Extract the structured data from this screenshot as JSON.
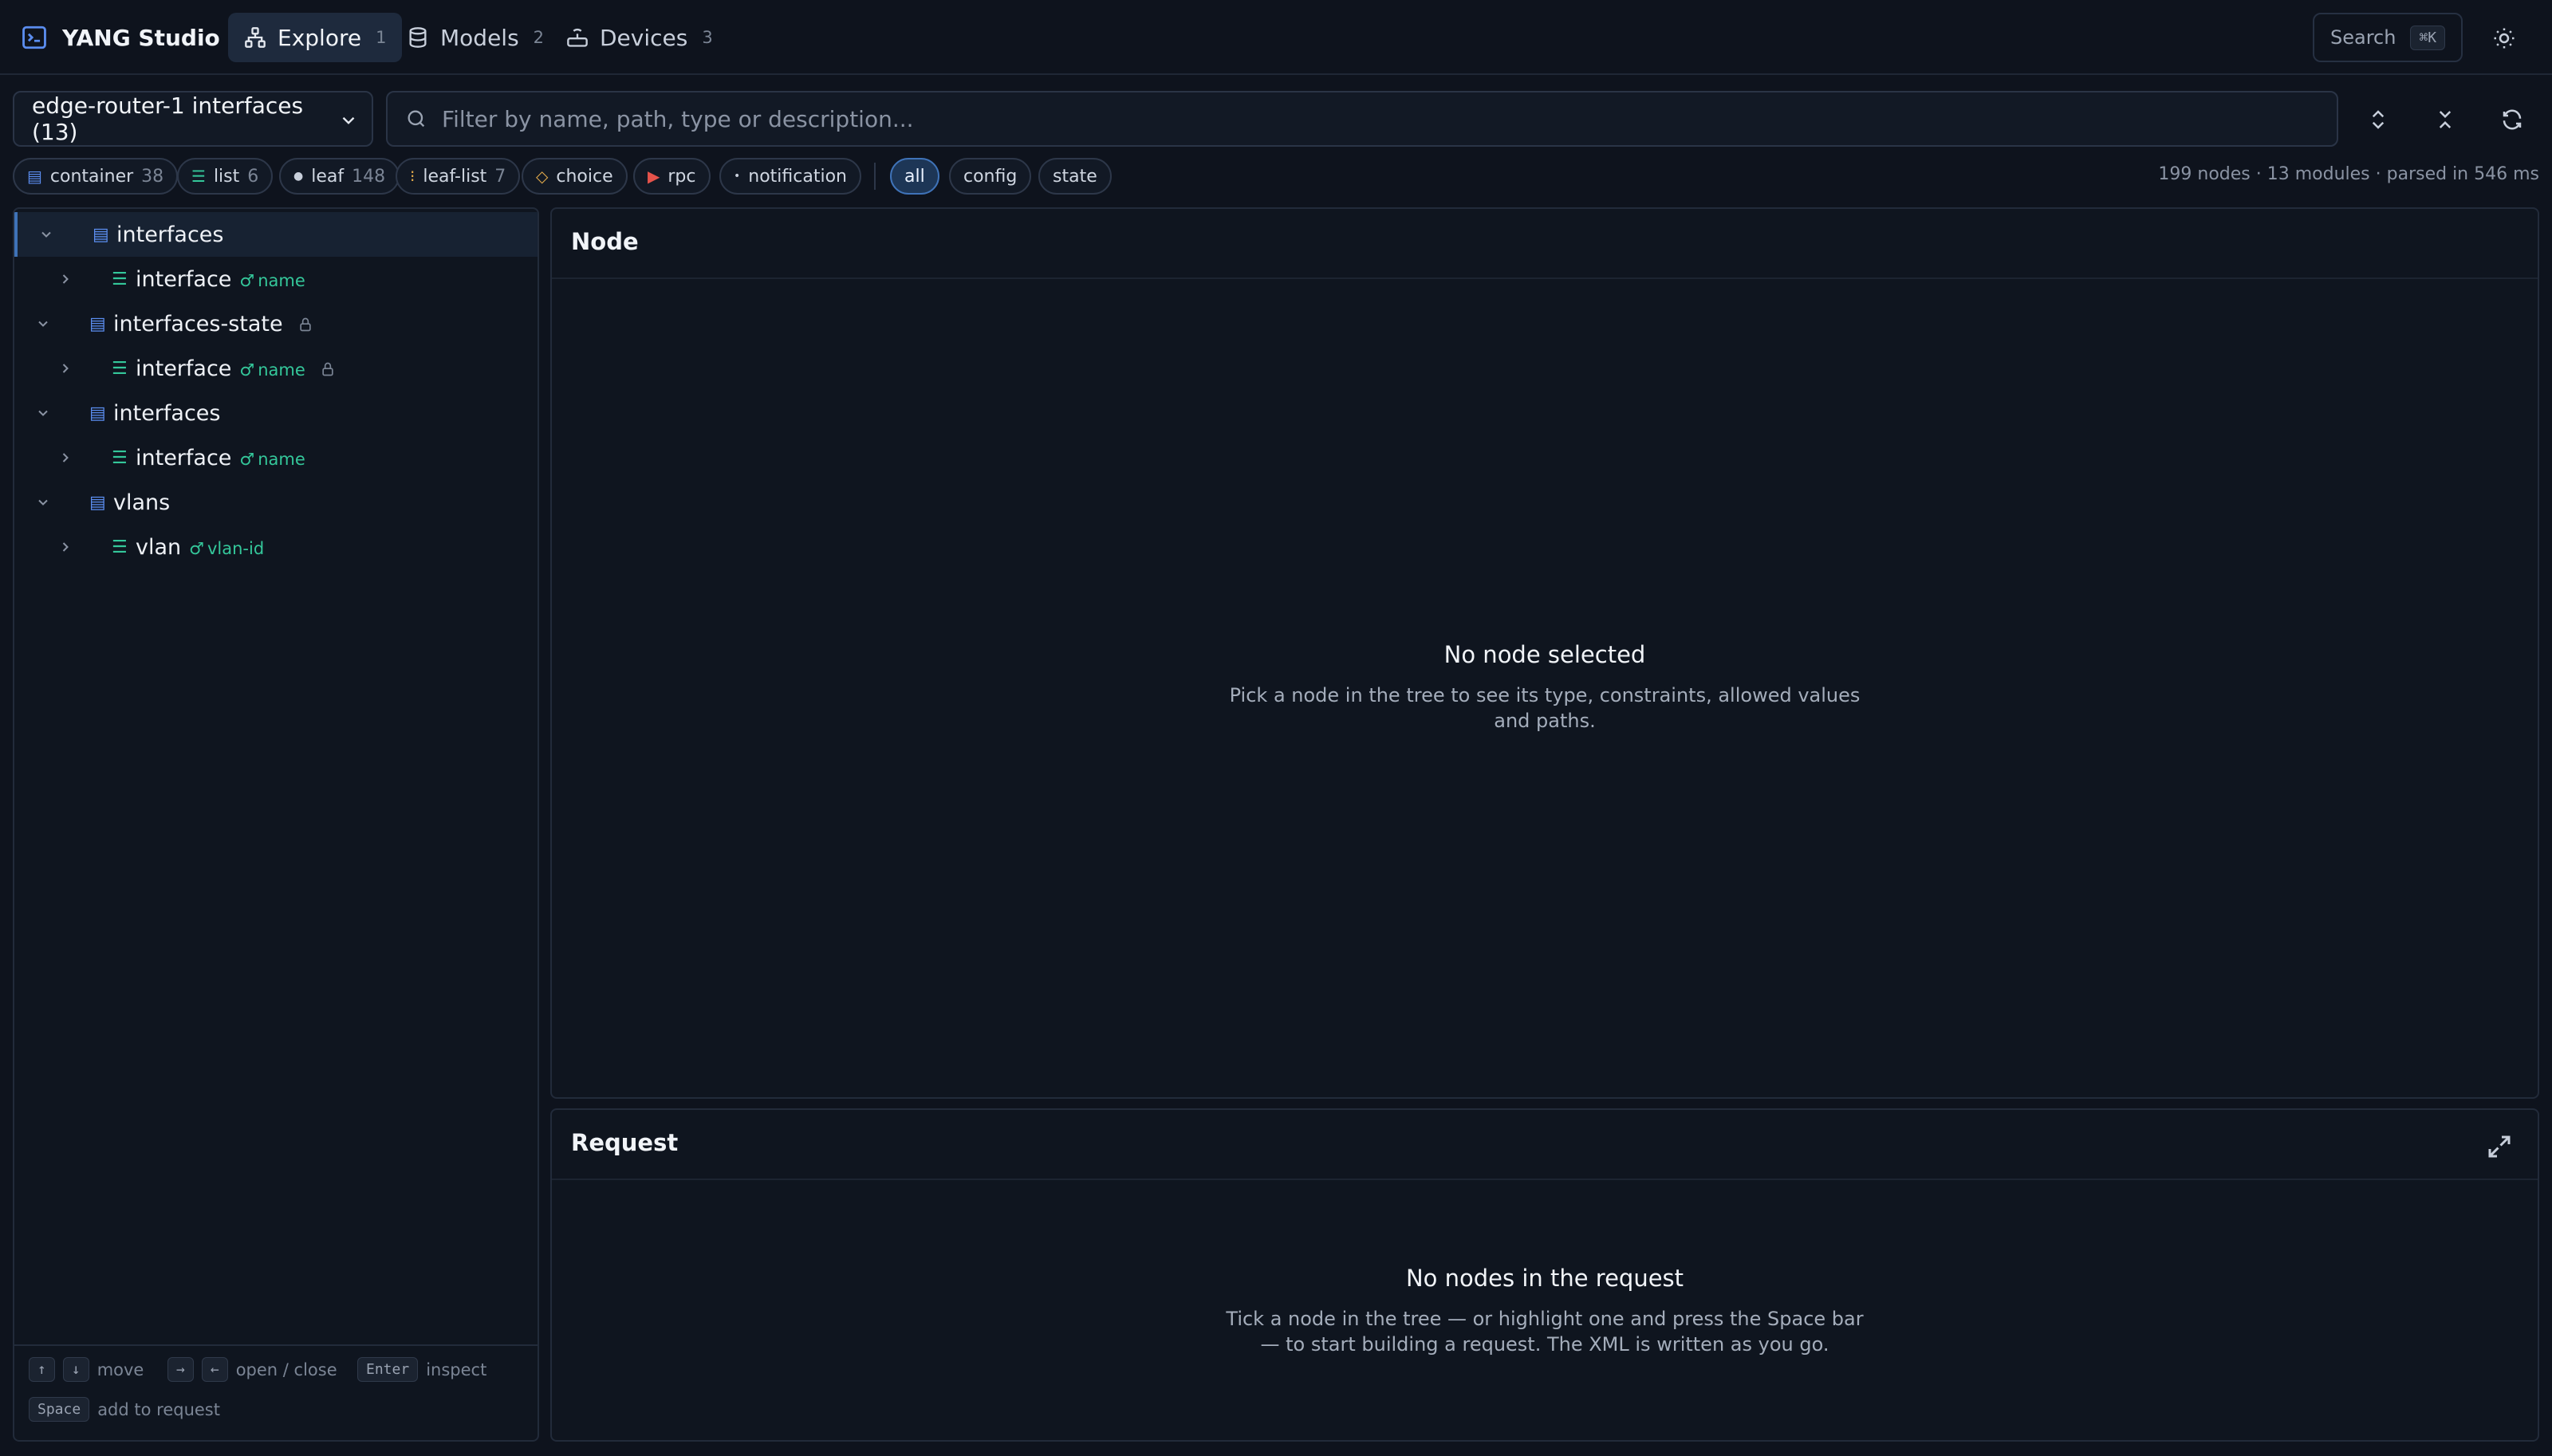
{
  "app": {
    "title": "YANG Studio"
  },
  "nav": {
    "tabs": [
      {
        "label": "Explore",
        "count": "1"
      },
      {
        "label": "Models",
        "count": "2"
      },
      {
        "label": "Devices",
        "count": "3"
      }
    ],
    "search_label": "Search",
    "search_shortcut": "⌘K"
  },
  "toolbar": {
    "source_select": "edge-router-1 interfaces (13)",
    "filter_placeholder": "Filter by name, path, type or description..."
  },
  "chips": {
    "container": {
      "label": "container",
      "count": "38"
    },
    "list": {
      "label": "list",
      "count": "6"
    },
    "leaf": {
      "label": "leaf",
      "count": "148"
    },
    "leaflist": {
      "label": "leaf-list",
      "count": "7"
    },
    "choice": {
      "label": "choice"
    },
    "rpc": {
      "label": "rpc"
    },
    "notification": {
      "label": "notification"
    },
    "all": {
      "label": "all"
    },
    "config": {
      "label": "config"
    },
    "state": {
      "label": "state"
    }
  },
  "stats": "199 nodes · 13 modules · parsed in 546 ms",
  "tree": {
    "rows": [
      {
        "label": "interfaces"
      },
      {
        "label": "interface",
        "key": "name"
      },
      {
        "label": "interfaces-state"
      },
      {
        "label": "interface",
        "key": "name"
      },
      {
        "label": "interfaces"
      },
      {
        "label": "interface",
        "key": "name"
      },
      {
        "label": "vlans"
      },
      {
        "label": "vlan",
        "key": "vlan-id"
      }
    ],
    "hints": {
      "move": "move",
      "open_close": "open / close",
      "enter_key": "Enter",
      "inspect": "inspect",
      "space_key": "Space",
      "add": "add to request"
    }
  },
  "node_panel": {
    "title": "Node",
    "empty_title": "No node selected",
    "empty_desc_1": "Pick a node in the tree to see its type, constraints, allowed values",
    "empty_desc_2": "and paths."
  },
  "request_panel": {
    "title": "Request",
    "empty_title": "No nodes in the request",
    "empty_desc_1": "Tick a node in the tree — or highlight one and press the Space bar",
    "empty_desc_2": "— to start building a request. The XML is written as you go."
  },
  "colors": {
    "accent": "#3f73b8",
    "key": "#34c79a",
    "container_icon": "#5b8def",
    "list_icon": "#34c79a",
    "rpc_icon": "#e5534b",
    "choice_icon": "#e0a94b"
  }
}
